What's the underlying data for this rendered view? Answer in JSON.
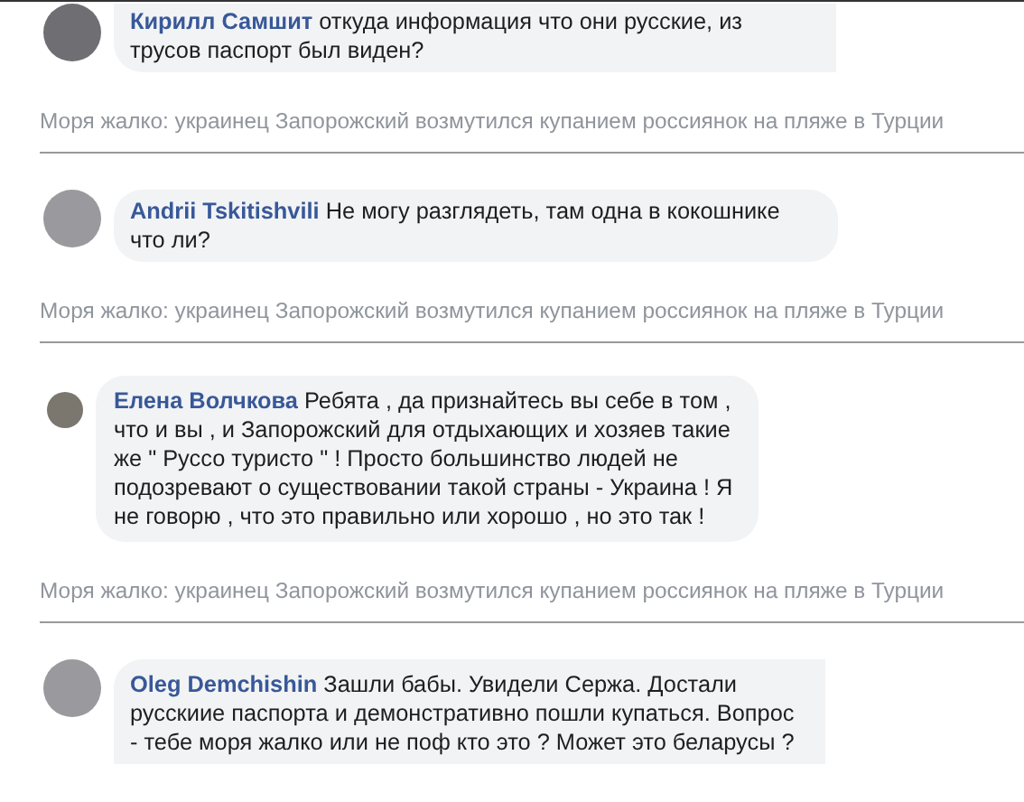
{
  "feed": [
    {
      "author": "Кирилл Самшит",
      "text": "откуда информация что они русские, из трусов паспорт был виден?",
      "source": "Моря жалко: украинец Запорожский возмутился купанием россиянок на пляже в Турции"
    },
    {
      "author": "Andrii Tskitishvili",
      "text": "Не могу разглядеть, там одна в кокошнике что ли?",
      "source": "Моря жалко: украинец Запорожский возмутился купанием россиянок на пляже в Турции"
    },
    {
      "author": "Елена Волчкова",
      "text": "Ребята , да признайтесь вы себе в том , что и вы , и Запорожский для отдыхающих и хозяев такие же \" Руссо туристо \" ! Просто большинство людей не подозревают о существовании такой страны - Украина ! Я не говорю , что это правильно или хорошо , но это так !",
      "source": "Моря жалко: украинец Запорожский возмутился купанием россиянок на пляже в Турции"
    },
    {
      "author": "Oleg Demchishin",
      "text": "Зашли бабы. Увидели Сержа. Достали русскиие паспорта и демонстративно пошли купаться. Вопрос - тебе моря жалко или не поф кто это ? Может это беларусы ?"
    }
  ]
}
